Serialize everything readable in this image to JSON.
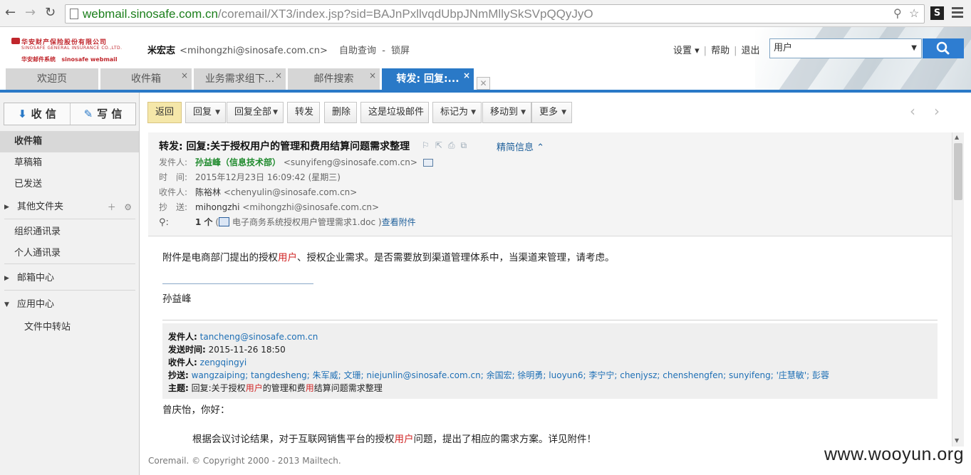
{
  "browser": {
    "url_host": "webmail.sinosafe.com.cn",
    "url_path": "/coremail/XT3/index.jsp?sid=BAJnPxllvqdUbpJNmMllySkSVpQQyJyO",
    "ext_label": "S"
  },
  "header": {
    "logo": {
      "company": "华安财产保险股份有限公司",
      "company_en": "SINOSAFE GENERAL INSURANCE CO.,LTD.",
      "system": "华安邮件系统",
      "system_en": "sinosafe webmail"
    },
    "user_name": "米宏志",
    "user_email": "<mihongzhi@sinosafe.com.cn>",
    "links": [
      "自助查询",
      "锁屏"
    ],
    "link_sep": "-",
    "top_links": [
      "设置 ▾",
      "帮助",
      "退出"
    ],
    "top_sep": "|",
    "search": {
      "scope": "用户"
    }
  },
  "tabs": [
    {
      "label": "欢迎页"
    },
    {
      "label": "收件箱",
      "close": "×"
    },
    {
      "label": "业务需求组下...",
      "close": "×"
    },
    {
      "label": "邮件搜索",
      "close": "×"
    },
    {
      "label": "转发: 回复:...",
      "close": "×"
    }
  ],
  "sidebar": {
    "receive": "收 信",
    "compose": "写 信",
    "items": [
      {
        "label": "收件箱"
      },
      {
        "label": "草稿箱"
      },
      {
        "label": "已发送"
      },
      {
        "label": "其他文件夹"
      },
      {
        "label": "组织通讯录"
      },
      {
        "label": "个人通讯录"
      },
      {
        "label": "邮箱中心"
      },
      {
        "label": "应用中心"
      },
      {
        "label": "文件中转站"
      }
    ]
  },
  "toolbar": {
    "back": "返回",
    "reply": "回复",
    "reply_all": "回复全部",
    "forward": "转发",
    "delete": "删除",
    "spam": "这是垃圾邮件",
    "mark_as": "标记为",
    "move_to": "移动到",
    "more": "更多"
  },
  "mail": {
    "subject": "转发: 回复:关于授权用户的管理和费用结算问题需求整理",
    "detail_link": "精简信息",
    "labels": {
      "from": "发件人:",
      "time": "时　间:",
      "to": "收件人:",
      "cc": "抄　送:"
    },
    "from_name": "孙益峰（信息技术部）",
    "from_addr": "<sunyifeng@sinosafe.com.cn>",
    "time": "2015年12月23日 16:09:42 (星期三)",
    "to_name": "陈裕林",
    "to_addr": "<chenyulin@sinosafe.com.cn>",
    "cc_name": "mihongzhi",
    "cc_addr": "<mihongzhi@sinosafe.com.cn>",
    "attach_label": ":",
    "attach_count": "1 个",
    "attach_open": "(",
    "attach_name": "电子商务系统授权用户管理需求1.doc",
    "attach_close": ")",
    "attach_view": "查看附件",
    "body": {
      "p1_a": "附件是电商部门提出的授权",
      "p1_hl": "用户",
      "p1_b": "、授权企业需求。是否需要放到渠道管理体系中，当渠道来管理，请考虑。",
      "signature": "孙益峰",
      "greeting": "曾庆怡，你好：",
      "p2_a": "根据会议讨论结果，对于互联网销售平台的授权",
      "p2_hl": "用户",
      "p2_b": "问题，提出了相应的需求方案。详见附件！"
    },
    "quote": {
      "from_label": "发件人:",
      "from": "tancheng@sinosafe.com.cn",
      "sent_label": "发送时间:",
      "sent": "2015-11-26 18:50",
      "to_label": "收件人:",
      "to": "zengqingyi",
      "cc_label": "抄送:",
      "cc": "wangzaiping; tangdesheng; 朱军威; 文珊; niejunlin@sinosafe.com.cn; 余国宏; 徐明勇; luoyun6; 李宁宁; chenjysz; chenshengfen; sunyifeng; '庄慧敏'; 彭蓉",
      "subject_label": "主题:",
      "subject_a": "回复:关于授权",
      "subject_hl1": "用户",
      "subject_b": "的管理和费",
      "subject_hl2": "用",
      "subject_c": "结算问题需求整理"
    }
  },
  "footer": "Coremail. © Copyright 2000 - 2013 Mailtech.",
  "watermark": "www.wooyun.org"
}
